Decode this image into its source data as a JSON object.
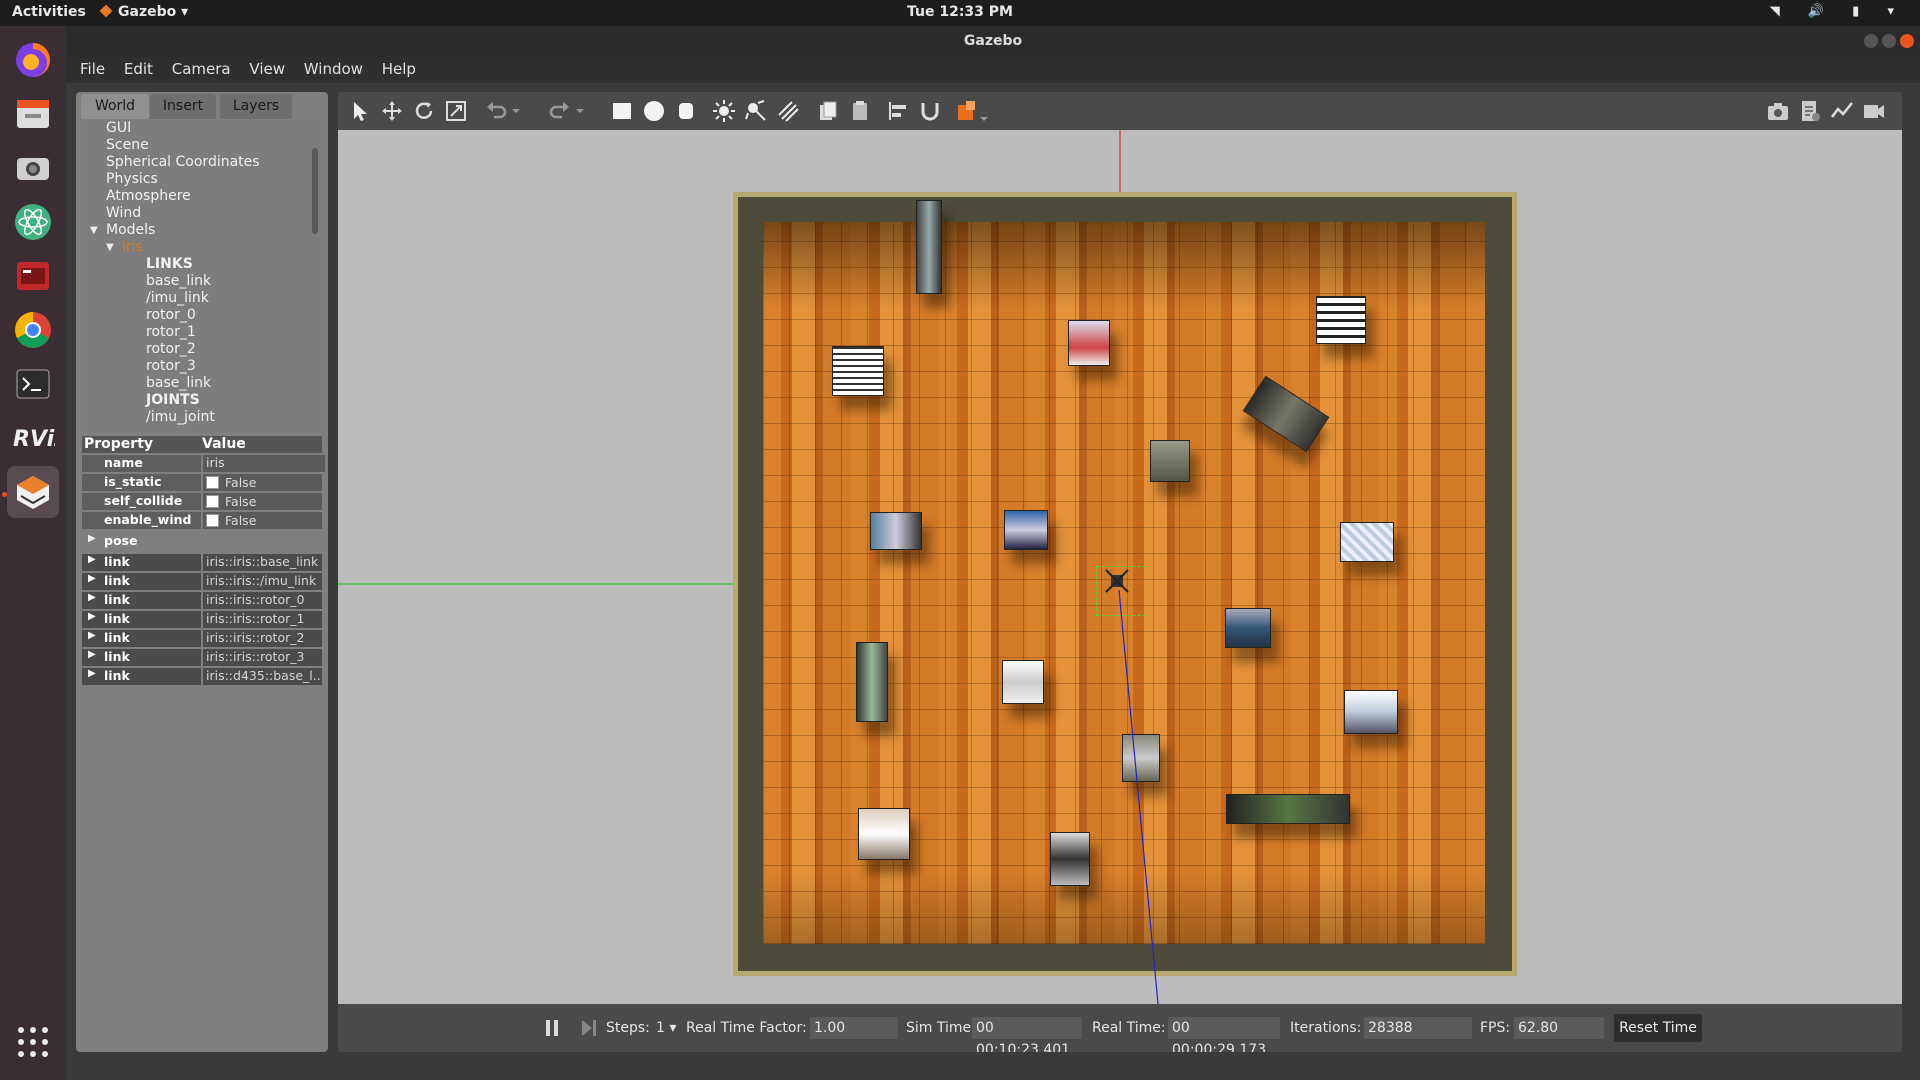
{
  "topbar": {
    "activities": "Activities",
    "app": "Gazebo ▾",
    "clock": "Tue 12:33 PM",
    "system_icons": "◥ 🔊 ▮ ▾"
  },
  "window": {
    "title": "Gazebo",
    "menu": [
      "File",
      "Edit",
      "Camera",
      "View",
      "Window",
      "Help"
    ]
  },
  "tabs": [
    "World",
    "Insert",
    "Layers"
  ],
  "tree": {
    "items": [
      {
        "label": "GUI",
        "indent": 0
      },
      {
        "label": "Scene",
        "indent": 0
      },
      {
        "label": "Spherical Coordinates",
        "indent": 0
      },
      {
        "label": "Physics",
        "indent": 0
      },
      {
        "label": "Atmosphere",
        "indent": 0
      },
      {
        "label": "Wind",
        "indent": 0
      },
      {
        "label": "Models",
        "indent": 0,
        "expander": "▼"
      },
      {
        "label": "iris",
        "indent": 1,
        "expander": "▼",
        "selected": true
      },
      {
        "label": "LINKS",
        "indent": 2,
        "bold": true
      },
      {
        "label": "base_link",
        "indent": 2
      },
      {
        "label": "/imu_link",
        "indent": 2
      },
      {
        "label": "rotor_0",
        "indent": 2
      },
      {
        "label": "rotor_1",
        "indent": 2
      },
      {
        "label": "rotor_2",
        "indent": 2
      },
      {
        "label": "rotor_3",
        "indent": 2
      },
      {
        "label": "base_link",
        "indent": 2
      },
      {
        "label": "JOINTS",
        "indent": 2,
        "bold": true
      },
      {
        "label": "/imu_joint",
        "indent": 2
      }
    ]
  },
  "properties": {
    "header": {
      "property": "Property",
      "value": "Value"
    },
    "rows": [
      {
        "name": "name",
        "value": "iris"
      },
      {
        "name": "is_static",
        "value": "False",
        "checkbox": true
      },
      {
        "name": "self_collide",
        "value": "False",
        "checkbox": true
      },
      {
        "name": "enable_wind",
        "value": "False",
        "checkbox": true
      }
    ],
    "pose_label": "pose",
    "links": [
      {
        "name": "link",
        "value": "iris::iris::base_link"
      },
      {
        "name": "link",
        "value": "iris::iris::/imu_link"
      },
      {
        "name": "link",
        "value": "iris::iris::rotor_0"
      },
      {
        "name": "link",
        "value": "iris::iris::rotor_1"
      },
      {
        "name": "link",
        "value": "iris::iris::rotor_2"
      },
      {
        "name": "link",
        "value": "iris::iris::rotor_3"
      },
      {
        "name": "link",
        "value": "iris::d435::base_l..."
      }
    ]
  },
  "bottom": {
    "steps_label": "Steps:",
    "steps_value": "1",
    "rtf_label": "Real Time Factor:",
    "rtf_value": "1.00",
    "sim_time_label": "Sim Time:",
    "sim_time_value": "00 00:10:23.401",
    "real_time_label": "Real Time:",
    "real_time_value": "00 00:00:29.173",
    "iterations_label": "Iterations:",
    "iterations_value": "28388",
    "fps_label": "FPS:",
    "fps_value": "62.80",
    "reset_label": "Reset Time"
  },
  "icons": {
    "toolbar": [
      "select-arrow-icon",
      "translate-icon",
      "rotate-icon",
      "scale-icon",
      "undo-icon",
      "undo-dropdown-icon",
      "redo-icon",
      "redo-dropdown-icon",
      "box-shape-icon",
      "sphere-shape-icon",
      "cylinder-shape-icon",
      "point-light-icon",
      "spot-light-icon",
      "directional-light-icon",
      "copy-icon",
      "paste-icon",
      "align-icon",
      "snap-icon",
      "view-angle-icon"
    ],
    "toolbar_right": [
      "screenshot-icon",
      "log-icon",
      "plot-icon",
      "record-icon"
    ]
  },
  "colors": {
    "selected_model": "#e07a10",
    "floor_wood": "#d37b27",
    "viewport_bg": "#bcbcbc",
    "reset_button": "#2e2e2e"
  }
}
